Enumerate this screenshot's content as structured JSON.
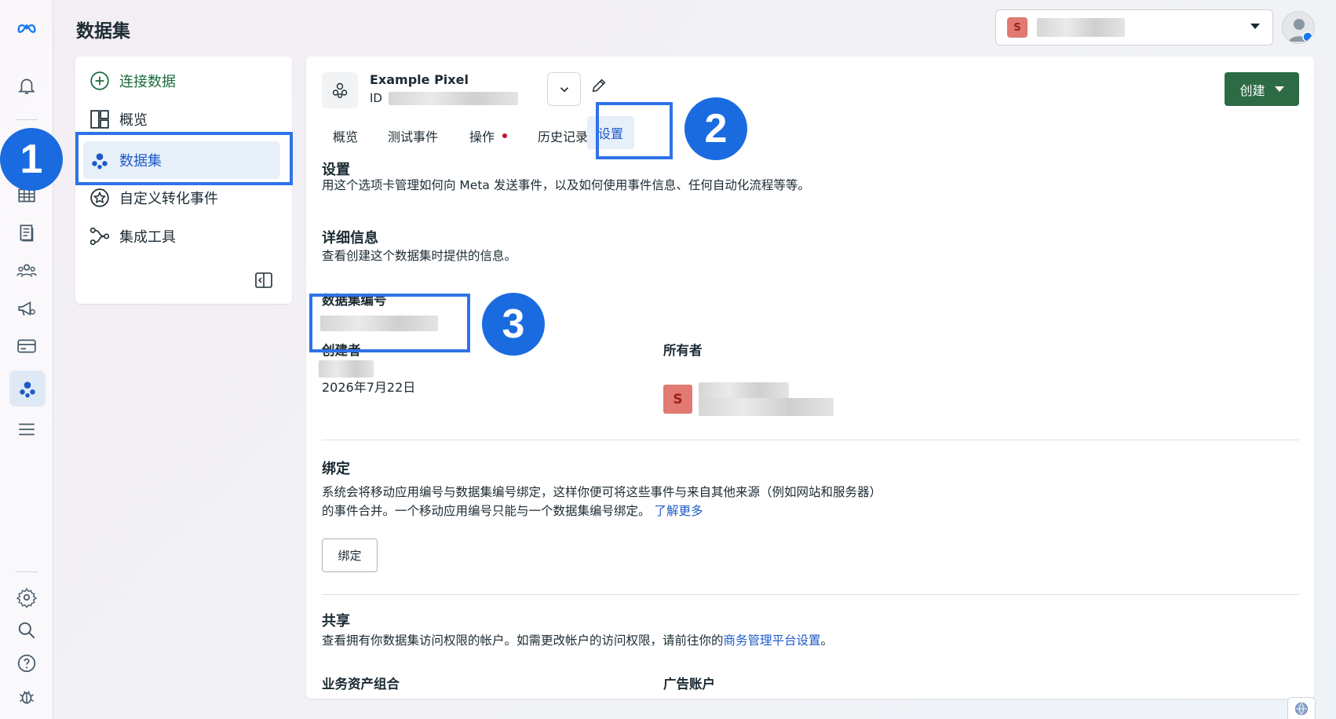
{
  "page": {
    "title": "数据集"
  },
  "account_selector": {
    "badge": "S"
  },
  "rail": {
    "icons": [
      "meta-logo-icon",
      "bell-icon",
      "table-icon",
      "pages-icon",
      "people-icon",
      "megaphone-icon",
      "credit-card-icon",
      "dataset-icon",
      "menu-icon",
      "settings-icon",
      "search-icon",
      "help-icon",
      "bug-icon"
    ]
  },
  "subnav": {
    "items": [
      {
        "label": "连接数据",
        "icon": "plus-circle-icon"
      },
      {
        "label": "概览",
        "icon": "overview-icon"
      },
      {
        "label": "数据集",
        "icon": "dataset-icon"
      },
      {
        "label": "自定义转化事件",
        "icon": "star-badge-icon"
      },
      {
        "label": "集成工具",
        "icon": "integration-icon"
      }
    ]
  },
  "steps": [
    "1",
    "2",
    "3"
  ],
  "pixel": {
    "name": "Example Pixel",
    "id_label": "ID"
  },
  "create_button": {
    "label": "创建"
  },
  "tabs": [
    {
      "label": "概览"
    },
    {
      "label": "测试事件"
    },
    {
      "label": "操作"
    },
    {
      "label": "历史记录"
    },
    {
      "label": "设置"
    }
  ],
  "settings": {
    "title": "设置",
    "desc": "用这个选项卡管理如何向 Meta 发送事件，以及如何使用事件信息、任何自动化流程等等。"
  },
  "details": {
    "title": "详细信息",
    "desc": "查看创建这个数据集时提供的信息。",
    "dataset_id_label": "数据集编号",
    "creator_label": "创建者",
    "created_date": "2026年7月22日",
    "owner_label": "所有者",
    "owner_badge": "S"
  },
  "binding": {
    "title": "绑定",
    "desc_line1": "系统会将移动应用编号与数据集编号绑定，这样你便可将这些事件与来自其他来源（例如网站和服务器）",
    "desc_line2": "的事件合并。一个移动应用编号只能与一个数据集编号绑定。",
    "learn_more": "了解更多",
    "button": "绑定"
  },
  "sharing": {
    "title": "共享",
    "desc": "查看拥有你数据集访问权限的帐户。如需更改帐户的访问权限，请前往你的",
    "link": "商务管理平台设置",
    "desc_end": "。",
    "portfolio_label": "业务资产组合",
    "ad_account_label": "广告账户"
  },
  "colors": {
    "accent": "#2f72e8",
    "create_button": "#2d6b45",
    "link": "#1d5ac8"
  }
}
